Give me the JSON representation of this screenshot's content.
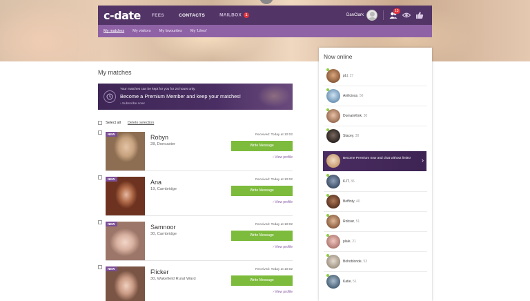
{
  "header": {
    "logo": "c-date",
    "nav": [
      {
        "label": "FEES",
        "active": false
      },
      {
        "label": "CONTACTS",
        "active": true
      },
      {
        "label": "MAILBOX",
        "active": false,
        "badge": "1"
      }
    ],
    "user_name": "DanClark",
    "contacts_badge": "13",
    "icons": [
      "contacts-icon",
      "eye-icon",
      "thumbs-up-icon"
    ]
  },
  "subnav": [
    {
      "label": "My matches",
      "active": true
    },
    {
      "label": "My visitors",
      "active": false
    },
    {
      "label": "My favourites",
      "active": false
    },
    {
      "label": "My 'Likes'",
      "active": false
    }
  ],
  "page_title": "My matches",
  "premium_banner": {
    "small": "Your matches can be kept for you for 24 hours only.",
    "big": "Become a Premium Member and keep your matches!",
    "link": "› Subscribe now!"
  },
  "selection": {
    "select_all": "Select all",
    "delete": "Delete selection"
  },
  "matches": [
    {
      "badge": "NEW",
      "name": "Robyn",
      "meta": "28, Doncaster",
      "received": "Received: Today at 10:02",
      "button": "Write Message",
      "view": "› View profile"
    },
    {
      "badge": "NEW",
      "name": "Ana",
      "meta": "19, Cambridge",
      "received": "Received: Today at 10:02",
      "button": "Write Message",
      "view": "› View profile"
    },
    {
      "badge": "NEW",
      "name": "Samnoor",
      "meta": "30, Cambridge",
      "received": "Received: Today at 10:02",
      "button": "Write Message",
      "view": "› View profile"
    },
    {
      "badge": "NEW",
      "name": "Flicker",
      "meta": "30, Wakefield Rural Ward",
      "received": "Received: Today at 10:02",
      "button": "Write Message",
      "view": "› View profile"
    }
  ],
  "online": {
    "title": "Now online",
    "users_top": [
      {
        "name": "pLt",
        "age": ", 27"
      },
      {
        "name": "Anilicious",
        "age": ", 56"
      },
      {
        "name": "DomainKink",
        "age": ", 30"
      },
      {
        "name": "Stacey",
        "age": ", 30"
      }
    ],
    "premium_text": "Become Premium now and chat without limits!",
    "users_bottom": [
      {
        "name": "KJT",
        "age": ", 36"
      },
      {
        "name": "Beffinty",
        "age": ", 40"
      },
      {
        "name": "Robsar",
        "age": ", 51"
      },
      {
        "name": "plale",
        "age": ", 21"
      },
      {
        "name": "Bohoblonde",
        "age": ", 53"
      },
      {
        "name": "Katie",
        "age": ", 51"
      }
    ]
  },
  "colors": {
    "topbar": "#523466",
    "subbar": "#8f62a6",
    "write_button": "#7dbb3c",
    "badge": "#e2343c",
    "online_dot": "#8ccd3e"
  }
}
